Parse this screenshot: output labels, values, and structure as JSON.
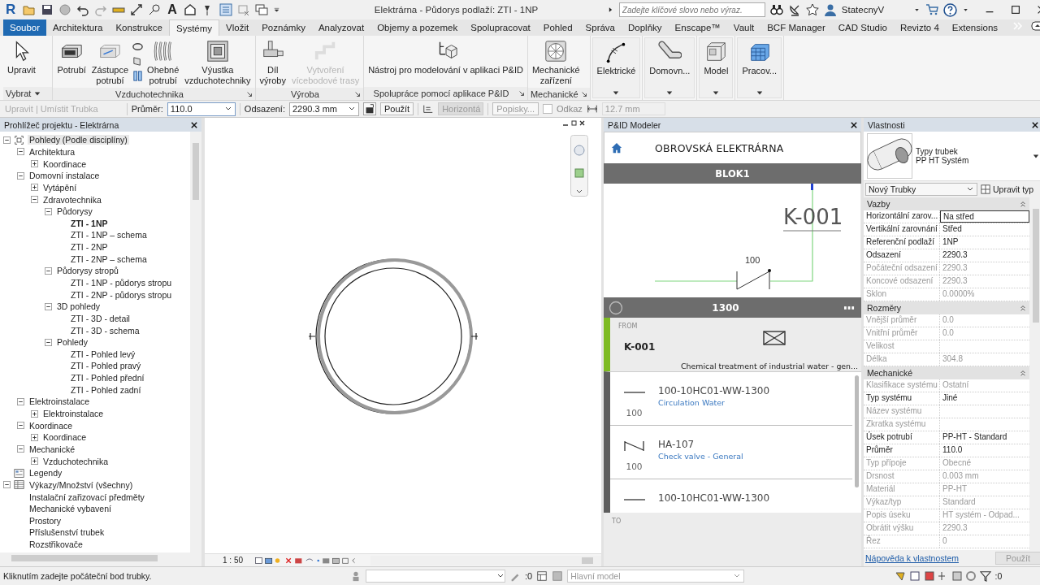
{
  "app": {
    "logo": "R",
    "text_tool": "A"
  },
  "window": {
    "title": "Elektrárna - Půdorys podlaží: ZTI - 1NP"
  },
  "search": {
    "placeholder": "Zadejte klíčové slovo nebo výraz."
  },
  "user": {
    "name": "StatecnyV"
  },
  "tabs": [
    {
      "label": "Soubor",
      "kind": "file",
      "selected": false
    },
    {
      "label": "Architektura",
      "kind": "tab",
      "selected": false
    },
    {
      "label": "Konstrukce",
      "kind": "tab",
      "selected": false
    },
    {
      "label": "Systémy",
      "kind": "tab",
      "selected": true
    },
    {
      "label": "Vložit",
      "kind": "tab",
      "selected": false
    },
    {
      "label": "Poznámky",
      "kind": "tab",
      "selected": false
    },
    {
      "label": "Analyzovat",
      "kind": "tab",
      "selected": false
    },
    {
      "label": "Objemy a pozemek",
      "kind": "tab",
      "selected": false
    },
    {
      "label": "Spolupracovat",
      "kind": "tab",
      "selected": false
    },
    {
      "label": "Pohled",
      "kind": "tab",
      "selected": false
    },
    {
      "label": "Správa",
      "kind": "tab",
      "selected": false
    },
    {
      "label": "Doplňky",
      "kind": "tab",
      "selected": false
    },
    {
      "label": "Enscape™",
      "kind": "tab",
      "selected": false
    },
    {
      "label": "Vault",
      "kind": "tab",
      "selected": false
    },
    {
      "label": "BCF Manager",
      "kind": "tab",
      "selected": false
    },
    {
      "label": "CAD Studio",
      "kind": "tab",
      "selected": false
    },
    {
      "label": "Revizto 4",
      "kind": "tab",
      "selected": false
    },
    {
      "label": "Extensions",
      "kind": "tab",
      "selected": false
    }
  ],
  "ribbon": {
    "panels": [
      {
        "kind": "panel",
        "label": "Vybrat",
        "dropdown": true,
        "launcher": false,
        "buttons": [
          {
            "kind": "large",
            "label": "Upravit",
            "disabled": false
          }
        ]
      },
      {
        "kind": "panel",
        "label": "Vzduchotechnika",
        "dropdown": false,
        "launcher": true,
        "buttons": [
          {
            "kind": "large",
            "label": "Potrubí",
            "disabled": false
          },
          {
            "kind": "large",
            "label": "Zástupce\npotrubí",
            "disabled": false
          },
          {
            "kind": "stack",
            "disabled": false
          },
          {
            "kind": "large",
            "label": "Ohebné\npotrubí",
            "disabled": false
          },
          {
            "kind": "large",
            "label": "Výustka\nvzduchotechniky",
            "disabled": false
          }
        ]
      },
      {
        "kind": "panel",
        "label": "Výroba",
        "dropdown": false,
        "launcher": true,
        "buttons": [
          {
            "kind": "large",
            "label": "Díl\nvýroby",
            "disabled": false
          },
          {
            "kind": "large",
            "label": "Vytvoření\nvícebodové trasy",
            "disabled": true
          }
        ]
      },
      {
        "kind": "panel",
        "label": "Spolupráce pomocí aplikace P&ID",
        "dropdown": false,
        "launcher": true,
        "buttons": [
          {
            "kind": "large",
            "label": "Nástroj pro modelování v aplikaci P&ID",
            "disabled": false
          }
        ]
      },
      {
        "kind": "panel",
        "label": "Mechanické",
        "dropdown": false,
        "launcher": true,
        "buttons": [
          {
            "kind": "large",
            "label": "Mechanické\nzařízení",
            "disabled": false
          }
        ]
      },
      {
        "kind": "collapsed",
        "label": "Elektrické"
      },
      {
        "kind": "collapsed",
        "label": "Domovn..."
      },
      {
        "kind": "collapsed",
        "label": "Model"
      },
      {
        "kind": "collapsed",
        "label": "Pracov..."
      }
    ]
  },
  "options": {
    "context": "Upravit | Umístit Trubka",
    "diameter": {
      "label": "Průměr:",
      "value": "110.0"
    },
    "offset": {
      "label": "Odsazení:",
      "value": "2290.3 mm"
    },
    "apply": "Použít",
    "justification": {
      "label": "Horizontá",
      "disabled": true
    },
    "tags": {
      "label": "Popisky...",
      "disabled": true
    },
    "link": {
      "label": "Odkaz",
      "checked": false
    },
    "radius": {
      "value": "12.7 mm",
      "disabled": true
    }
  },
  "browser": {
    "title": "Prohlížeč projektu - Elektrárna",
    "tree": [
      {
        "label": "Pohledy (Podle disciplíny)",
        "kind": "views",
        "expanded": true,
        "selected": true,
        "children": [
          {
            "label": "Architektura",
            "expanded": true,
            "selected": false,
            "children": [
              {
                "label": "Koordinace",
                "expanded": false,
                "selected": false
              }
            ]
          },
          {
            "label": "Domovní instalace",
            "expanded": true,
            "selected": false,
            "children": [
              {
                "label": "Vytápění",
                "expanded": false,
                "selected": false
              },
              {
                "label": "Zdravotechnika",
                "expanded": true,
                "selected": false,
                "children": [
                  {
                    "label": "Půdorysy",
                    "expanded": true,
                    "selected": false,
                    "children": [
                      {
                        "label": "ZTI - 1NP",
                        "selected": false,
                        "current": true
                      },
                      {
                        "label": "ZTI - 1NP – schema",
                        "selected": false
                      },
                      {
                        "label": "ZTI - 2NP",
                        "selected": false
                      },
                      {
                        "label": "ZTI - 2NP – schema",
                        "selected": false
                      }
                    ]
                  },
                  {
                    "label": "Půdorysy stropů",
                    "expanded": true,
                    "selected": false,
                    "children": [
                      {
                        "label": "ZTI - 1NP - půdorys stropu",
                        "selected": false
                      },
                      {
                        "label": "ZTI - 2NP - půdorys stropu",
                        "selected": false
                      }
                    ]
                  },
                  {
                    "label": "3D pohledy",
                    "expanded": true,
                    "selected": false,
                    "children": [
                      {
                        "label": "ZTI - 3D - detail",
                        "selected": false
                      },
                      {
                        "label": "ZTI - 3D - schema",
                        "selected": false
                      }
                    ]
                  },
                  {
                    "label": "Pohledy",
                    "expanded": true,
                    "selected": false,
                    "children": [
                      {
                        "label": "ZTI - Pohled levý",
                        "selected": false
                      },
                      {
                        "label": "ZTI - Pohled pravý",
                        "selected": false
                      },
                      {
                        "label": "ZTI - Pohled přední",
                        "selected": false
                      },
                      {
                        "label": "ZTI - Pohled zadní",
                        "selected": false
                      }
                    ]
                  }
                ]
              }
            ]
          },
          {
            "label": "Elektroinstalace",
            "expanded": true,
            "selected": false,
            "children": [
              {
                "label": "Elektroinstalace",
                "expanded": false,
                "selected": false
              }
            ]
          },
          {
            "label": "Koordinace",
            "expanded": true,
            "selected": false,
            "children": [
              {
                "label": "Koordinace",
                "expanded": false,
                "selected": false
              }
            ]
          },
          {
            "label": "Mechanické",
            "expanded": true,
            "selected": false,
            "children": [
              {
                "label": "Vzduchotechnika",
                "expanded": false,
                "selected": false
              }
            ]
          }
        ]
      },
      {
        "label": "Legendy",
        "kind": "legends",
        "selected": false
      },
      {
        "label": "Výkazy/Množství (všechny)",
        "kind": "schedules",
        "expanded": true,
        "selected": false,
        "children": [
          {
            "label": "Instalační zařizovací předměty",
            "selected": false
          },
          {
            "label": "Mechanické vybavení",
            "selected": false
          },
          {
            "label": "Prostory",
            "selected": false
          },
          {
            "label": "Příslušenství trubek",
            "selected": false
          },
          {
            "label": "Rozstřikovače",
            "selected": false
          }
        ]
      }
    ]
  },
  "view": {
    "scale": "1 : 50"
  },
  "pid": {
    "title": "P&ID Modeler",
    "project": "OBROVSKÁ ELEKTRÁRNA",
    "block": "BLOK1",
    "diagram": {
      "tag": "K-001",
      "size": "100"
    },
    "line": "1300",
    "from": {
      "label": "FROM",
      "tag": "K-001",
      "description": "Chemical treatment of industrial water - gen..."
    },
    "items": [
      {
        "kind": "pipe",
        "code": "100-10HC01-WW-1300",
        "description": "Circulation Water",
        "size": "100"
      },
      {
        "kind": "valve",
        "code": "HA-107",
        "description": "Check valve - General",
        "size": "100"
      },
      {
        "kind": "pipe",
        "code": "100-10HC01-WW-1300"
      }
    ],
    "to": {
      "label": "TO"
    }
  },
  "properties": {
    "title": "Vlastnosti",
    "family": "Typy trubek",
    "type": "PP HT Systém",
    "instance": "Nový Trubky",
    "edit_type": "Upravit typ",
    "groups": [
      {
        "label": "Vazby",
        "rows": [
          {
            "name": "Horizontální zarov...",
            "value": "Na střed",
            "editable": true,
            "focused": true
          },
          {
            "name": "Vertikální zarovnání",
            "value": "Střed",
            "editable": true,
            "focused": false
          },
          {
            "name": "Referenční podlaží",
            "value": "1NP",
            "editable": true,
            "focused": false
          },
          {
            "name": "Odsazení",
            "value": "2290.3",
            "editable": true,
            "focused": false
          },
          {
            "name": "Počáteční odsazení",
            "value": "2290.3",
            "editable": false,
            "focused": false
          },
          {
            "name": "Koncové odsazení",
            "value": "2290.3",
            "editable": false,
            "focused": false
          },
          {
            "name": "Sklon",
            "value": "0.0000%",
            "editable": false,
            "focused": false
          }
        ]
      },
      {
        "label": "Rozměry",
        "rows": [
          {
            "name": "Vnější průměr",
            "value": "0.0",
            "editable": false,
            "focused": false
          },
          {
            "name": "Vnitřní průměr",
            "value": "0.0",
            "editable": false,
            "focused": false
          },
          {
            "name": "Velikost",
            "editable": false,
            "focused": false
          },
          {
            "name": "Délka",
            "value": "304.8",
            "editable": false,
            "focused": false
          }
        ]
      },
      {
        "label": "Mechanické",
        "rows": [
          {
            "name": "Klasifikace systému",
            "value": "Ostatní",
            "editable": false,
            "focused": false
          },
          {
            "name": "Typ systému",
            "value": "Jiné",
            "editable": true,
            "focused": false
          },
          {
            "name": "Název systému",
            "editable": false,
            "focused": false
          },
          {
            "name": "Zkratka systému",
            "editable": false,
            "focused": false
          },
          {
            "name": "Úsek potrubí",
            "value": "PP-HT - Standard",
            "editable": true,
            "focused": false
          },
          {
            "name": "Průměr",
            "value": "110.0",
            "editable": true,
            "focused": false
          },
          {
            "name": "Typ přípoje",
            "value": "Obecné",
            "editable": false,
            "focused": false
          },
          {
            "name": "Drsnost",
            "value": "0.003 mm",
            "editable": false,
            "focused": false
          },
          {
            "name": "Materiál",
            "value": "PP-HT",
            "editable": false,
            "focused": false
          },
          {
            "name": "Výkaz/typ",
            "value": "Standard",
            "editable": false,
            "focused": false
          },
          {
            "name": "Popis úseku",
            "value": "HT systém - Odpad...",
            "editable": false,
            "focused": false
          },
          {
            "name": "Obrátit výšku",
            "value": "2290.3",
            "editable": false,
            "focused": false
          },
          {
            "name": "Řez",
            "value": "0",
            "editable": false,
            "focused": false
          }
        ]
      }
    ],
    "help": "Nápověda k vlastnostem",
    "apply": {
      "label": "Použít",
      "disabled": true
    }
  },
  "status": {
    "prompt": "Kliknutím zadejte počáteční bod trubky.",
    "worksets": ":0",
    "model": {
      "value": "Hlavní model",
      "disabled": true
    },
    "filter": ":0"
  }
}
